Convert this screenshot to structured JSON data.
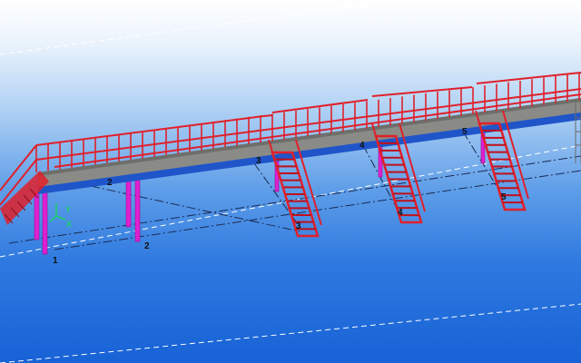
{
  "viewport": {
    "background_top": "#ffffff",
    "background_bottom": "#1762d6"
  },
  "colors": {
    "railing": "#e0202a",
    "deck": "#8a8a86",
    "deck_edge": "#1f55c9",
    "columns": "#e020d0",
    "stair": "#e0202a",
    "gridline": "#ffffff"
  },
  "axis_triad": {
    "y_label": "Y",
    "x_label": "X",
    "icon": "axis-triad-icon"
  },
  "grid_labels": [
    "1",
    "2",
    "2",
    "3",
    "3",
    "4",
    "4",
    "5",
    "5"
  ]
}
